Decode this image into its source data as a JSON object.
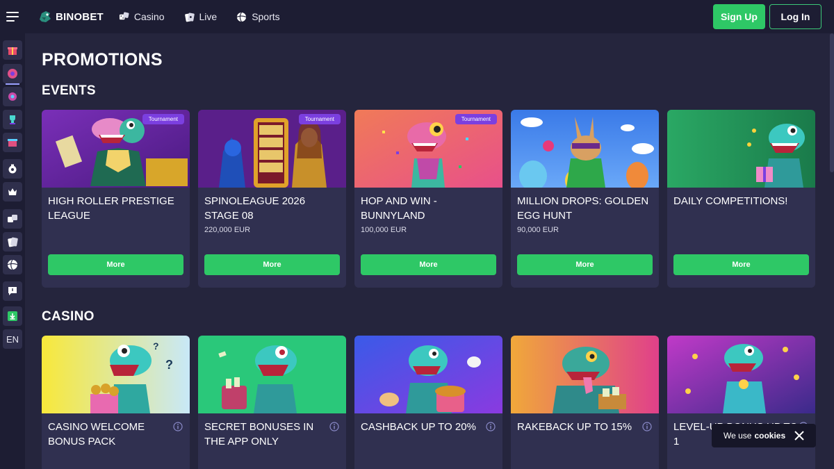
{
  "header": {
    "logo_text": "BINOBET",
    "nav": [
      {
        "label": "Casino",
        "icon": "dice-icon"
      },
      {
        "label": "Live",
        "icon": "cards-icon"
      },
      {
        "label": "Sports",
        "icon": "ball-icon"
      }
    ],
    "signup_label": "Sign Up",
    "login_label": "Log In"
  },
  "sidebar": {
    "items": [
      "gift-icon",
      "wheel-icon",
      "tournament-icon",
      "trophy-icon",
      "shop-icon",
      "bag-icon",
      "crown-icon",
      "dice-icon",
      "cards-icon",
      "ball-icon",
      "chat-icon",
      "download-icon"
    ],
    "language": "EN"
  },
  "page": {
    "title": "PROMOTIONS"
  },
  "events": {
    "title": "EVENTS",
    "cards": [
      {
        "title": "HIGH ROLLER PRESTIGE LEAGUE",
        "amount": "",
        "badge": "Tournament",
        "button": "More"
      },
      {
        "title": "SPINOLEAGUE 2026 STAGE 08",
        "amount": "220,000 EUR",
        "badge": "Tournament",
        "button": "More"
      },
      {
        "title": "HOP AND WIN - BUNNYLAND",
        "amount": "100,000 EUR",
        "badge": "Tournament",
        "button": "More"
      },
      {
        "title": "MILLION DROPS: GOLDEN EGG HUNT",
        "amount": "90,000 EUR",
        "badge": "",
        "button": "More"
      },
      {
        "title": "DAILY COMPETITIONS!",
        "amount": "",
        "badge": "",
        "button": "More"
      }
    ]
  },
  "casino": {
    "title": "CASINO",
    "cards": [
      {
        "title": "CASINO WELCOME BONUS PACK"
      },
      {
        "title": "SECRET BONUSES IN THE APP ONLY"
      },
      {
        "title": "CASHBACK UP TO 20%"
      },
      {
        "title": "RAKEBACK UP TO 15%"
      },
      {
        "title": "LEVEL-UP BONUS UP TO 1"
      }
    ]
  },
  "cookie": {
    "text": "We use",
    "link": "cookies"
  },
  "colors": {
    "background": "#25253d",
    "topbar": "#1d1d33",
    "card": "#303050",
    "accent_green": "#2ec866",
    "badge_purple": "#7b3fe0"
  }
}
